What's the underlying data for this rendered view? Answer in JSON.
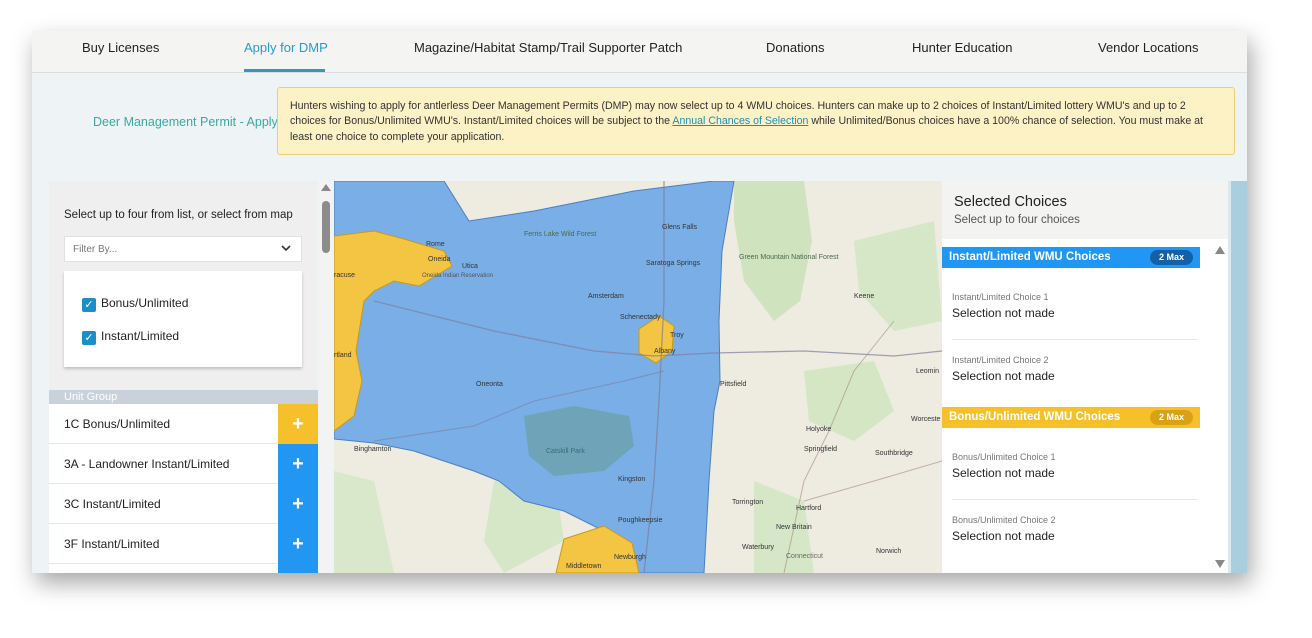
{
  "nav": {
    "items": [
      {
        "label": "Buy Licenses"
      },
      {
        "label": "Apply for DMP",
        "active": true
      },
      {
        "label": "Magazine/Habitat Stamp/Trail Supporter Patch"
      },
      {
        "label": "Donations"
      },
      {
        "label": "Hunter Education"
      },
      {
        "label": "Vendor Locations"
      }
    ]
  },
  "breadcrumb": "Deer Management Permit - Apply",
  "notice": {
    "text_before": "Hunters wishing to apply for antlerless Deer Management Permits (DMP) may now select up to 4 WMU choices. Hunters can make up to 2 choices of Instant/Limited lottery WMU's and up to 2 choices for Bonus/Unlimited WMU's. Instant/Limited choices will be subject to the ",
    "link": "Annual Chances of Selection",
    "text_after": " while Unlimited/Bonus choices have a 100% chance of selection. You must make at least one choice to complete your application."
  },
  "left_panel": {
    "title": "Select up to four from list, or select from map",
    "filter_placeholder": "Filter By...",
    "checkboxes": [
      {
        "label": "Bonus/Unlimited",
        "checked": true
      },
      {
        "label": "Instant/Limited",
        "checked": true
      }
    ],
    "unit_group_header": "Unit Group",
    "units": [
      {
        "label": "1C Bonus/Unlimited",
        "kind": "bonus"
      },
      {
        "label": "3A - Landowner Instant/Limited",
        "kind": "instant"
      },
      {
        "label": "3C Instant/Limited",
        "kind": "instant"
      },
      {
        "label": "3F Instant/Limited",
        "kind": "instant"
      }
    ],
    "add_symbol": "+"
  },
  "map": {
    "labels": [
      "Ferris Lake Wild Forest",
      "Glens Falls",
      "Saratoga Springs",
      "Green Mountain National Forest",
      "Keene",
      "Rome",
      "Oneida",
      "Utica",
      "Oneida Indian Reservation",
      "racuse",
      "Amsterdam",
      "Schenectady",
      "Troy",
      "Albany",
      "Pittsfield",
      "Leomin",
      "Worceste",
      "Oneonta",
      "Holyoke",
      "Springfield",
      "Southbridge",
      "Binghamton",
      "Catskill Park",
      "Kingston",
      "Torrington",
      "Hartford",
      "New Britain",
      "Poughkeepsie",
      "Waterbury",
      "Connecticut",
      "Norwich",
      "Newburgh",
      "Middletown",
      "rtland",
      "Cortland"
    ],
    "colors": {
      "wmu_instant": "#7aaee6",
      "wmu_bonus": "#f4c542",
      "park": "#6fa3b8"
    }
  },
  "right_panel": {
    "title": "Selected Choices",
    "subtitle": "Select up to four choices",
    "instant_group": {
      "title": "Instant/Limited WMU Choices",
      "badge": "2 Max",
      "color": "#2196f3"
    },
    "instant_choices": [
      {
        "label": "Instant/Limited Choice 1",
        "value": "Selection not made"
      },
      {
        "label": "Instant/Limited Choice 2",
        "value": "Selection not made"
      }
    ],
    "bonus_group": {
      "title": "Bonus/Unlimited WMU Choices",
      "badge": "2 Max",
      "color": "#f5c02a"
    },
    "bonus_choices": [
      {
        "label": "Bonus/Unlimited Choice 1",
        "value": "Selection not made"
      },
      {
        "label": "Bonus/Unlimited Choice 2",
        "value": "Selection not made"
      }
    ]
  }
}
